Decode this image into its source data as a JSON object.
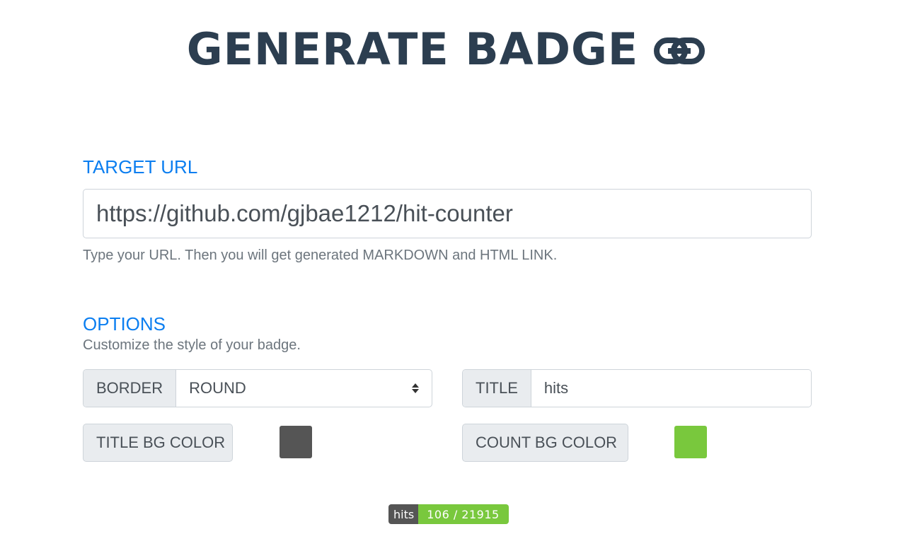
{
  "header": {
    "title": "GENERATE BADGE",
    "icon": "link-icon"
  },
  "target_url": {
    "label": "TARGET URL",
    "value": "https://github.com/gjbae1212/hit-counter",
    "help": "Type your URL. Then you will get generated MARKDOWN and HTML LINK."
  },
  "options": {
    "label": "OPTIONS",
    "help": "Customize the style of your badge.",
    "border": {
      "label": "BORDER",
      "selected": "ROUND"
    },
    "title": {
      "label": "TITLE",
      "value": "hits"
    },
    "title_bg": {
      "label": "TITLE BG COLOR",
      "color": "#555555"
    },
    "count_bg": {
      "label": "COUNT BG COLOR",
      "color": "#79C83D"
    }
  },
  "badge": {
    "title": "hits",
    "count": "106 / 21915",
    "title_color": "#555555",
    "count_color": "#79C83D"
  },
  "colors": {
    "heading": "#2C3E50",
    "accent": "#0B7EF0"
  }
}
